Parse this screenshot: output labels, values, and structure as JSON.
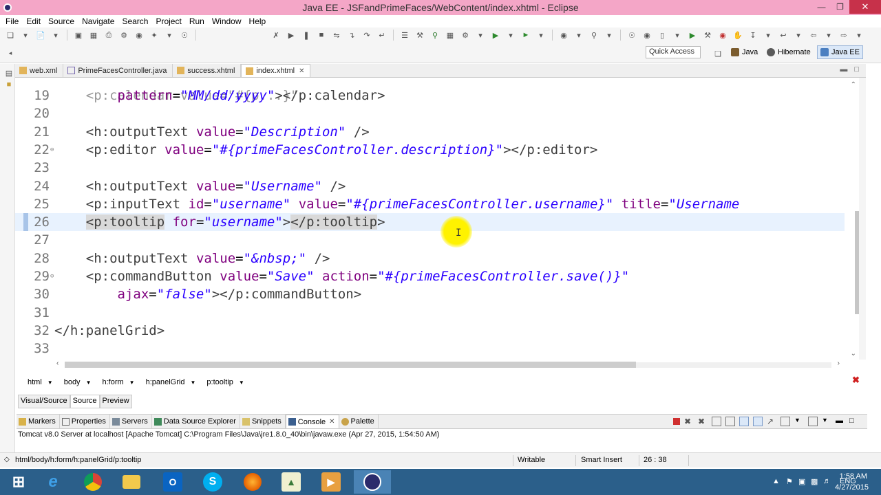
{
  "window": {
    "title": "Java EE - JSFandPrimeFaces/WebContent/index.xhtml - Eclipse"
  },
  "menu": [
    "File",
    "Edit",
    "Source",
    "Navigate",
    "Search",
    "Project",
    "Run",
    "Window",
    "Help"
  ],
  "toolbar": {
    "quick_access": "Quick Access",
    "perspectives": [
      {
        "label": "Java",
        "active": false
      },
      {
        "label": "Hibernate",
        "active": false
      },
      {
        "label": "Java EE",
        "active": true
      }
    ]
  },
  "editor_tabs": [
    {
      "label": "web.xml",
      "active": false
    },
    {
      "label": "PrimeFacesController.java",
      "active": false
    },
    {
      "label": "success.xhtml",
      "active": false
    },
    {
      "label": "index.xhtml",
      "active": true
    }
  ],
  "code_lines": [
    {
      "num": "19",
      "text": "        pattern=\"MM/dd/yyyy\"></p:calendar>"
    },
    {
      "num": "20",
      "text": ""
    },
    {
      "num": "21",
      "text": "    <h:outputText value=\"Description\" />"
    },
    {
      "num": "22",
      "text": "    <p:editor value=\"#{primeFacesController.description}\"></p:editor>"
    },
    {
      "num": "23",
      "text": ""
    },
    {
      "num": "24",
      "text": "    <h:outputText value=\"Username\" />"
    },
    {
      "num": "25",
      "text": "    <p:inputText id=\"username\" value=\"#{primeFacesController.username}\" title=\"Username"
    },
    {
      "num": "26",
      "text": "    <p:tooltip for=\"username\"></p:tooltip>"
    },
    {
      "num": "27",
      "text": ""
    },
    {
      "num": "28",
      "text": "    <h:outputText value=\"&nbsp;\" />"
    },
    {
      "num": "29",
      "text": "    <p:commandButton value=\"Save\" action=\"#{primeFacesController.save()}\""
    },
    {
      "num": "30",
      "text": "        ajax=\"false\"></p:commandButton>"
    },
    {
      "num": "31",
      "text": ""
    },
    {
      "num": "32",
      "text": "</h:panelGrid>"
    },
    {
      "num": "33",
      "text": ""
    }
  ],
  "breadcrumb": [
    "html",
    "body",
    "h:form",
    "h:panelGrid",
    "p:tooltip"
  ],
  "view_tabs": [
    "Visual/Source",
    "Source",
    "Preview"
  ],
  "bottom_tabs": [
    {
      "label": "Markers",
      "active": false
    },
    {
      "label": "Properties",
      "active": false
    },
    {
      "label": "Servers",
      "active": false
    },
    {
      "label": "Data Source Explorer",
      "active": false
    },
    {
      "label": "Snippets",
      "active": false
    },
    {
      "label": "Console",
      "active": true
    },
    {
      "label": "Palette",
      "active": false
    }
  ],
  "console": {
    "description": "Tomcat v8.0 Server at localhost [Apache Tomcat] C:\\Program Files\\Java\\jre1.8.0_40\\bin\\javaw.exe (Apr 27, 2015, 1:54:50 AM)"
  },
  "status": {
    "path": "html/body/h:form/h:panelGrid/p:tooltip",
    "writable": "Writable",
    "insert_mode": "Smart Insert",
    "position": "26 : 38"
  },
  "taskbar": {
    "language": "ENG",
    "time": "1:58 AM",
    "date": "4/27/2015"
  },
  "colors": {
    "titlebar": "#f4a6c7",
    "taskbar": "#2b5f8a",
    "current_line": "#e8f2fe"
  }
}
